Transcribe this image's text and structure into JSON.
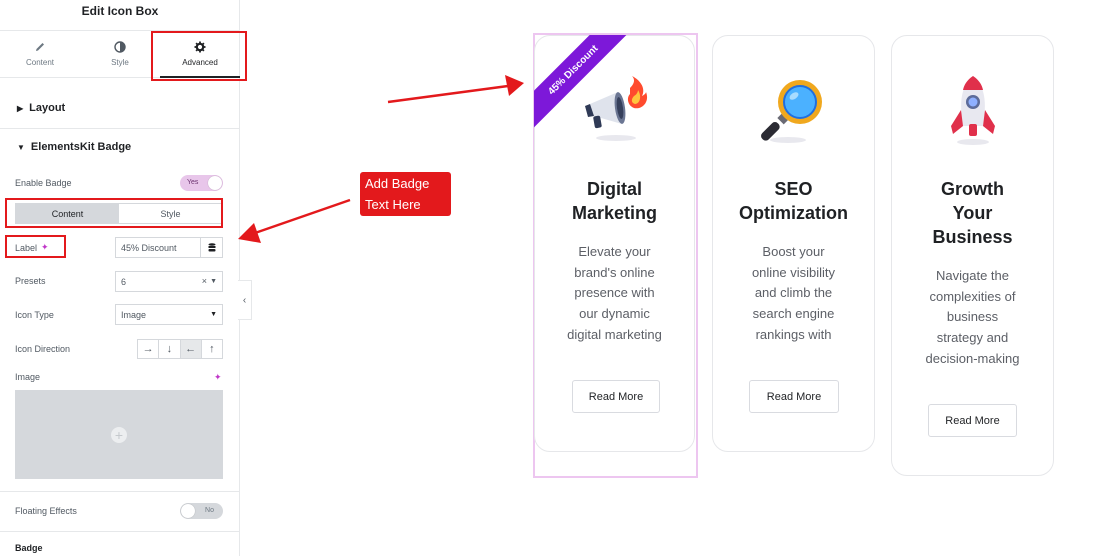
{
  "panel": {
    "title": "Edit Icon Box",
    "tabs": [
      {
        "label": "Content",
        "icon": "pencil-icon"
      },
      {
        "label": "Style",
        "icon": "contrast-icon"
      },
      {
        "label": "Advanced",
        "icon": "gear-icon"
      }
    ],
    "active_tab": "Advanced",
    "sections": {
      "layout": "Layout",
      "badge_section": "ElementsKit Badge",
      "badge_sub": "Badge"
    },
    "enable_badge": {
      "label": "Enable Badge",
      "state": "Yes"
    },
    "inner_tabs": [
      "Content",
      "Style"
    ],
    "label_field": {
      "label": "Label",
      "value": "45% Discount"
    },
    "presets": {
      "label": "Presets",
      "value": "6"
    },
    "icon_type": {
      "label": "Icon Type",
      "value": "Image"
    },
    "icon_direction": {
      "label": "Icon Direction",
      "options": [
        "→",
        "↓",
        "←",
        "↑"
      ],
      "selected": "←"
    },
    "image": {
      "label": "Image"
    },
    "floating_effects": {
      "label": "Floating Effects",
      "state": "No"
    }
  },
  "annotation": {
    "callout_line1": "Add Badge",
    "callout_line2": "Text Here",
    "color": "#e3191c"
  },
  "cards": [
    {
      "title_lines": [
        "Digital",
        "Marketing"
      ],
      "desc_lines": [
        "Elevate your",
        "brand's online",
        "presence with",
        "our dynamic",
        "digital marketing"
      ],
      "button": "Read More",
      "icon": "megaphone-icon",
      "badge": "45% Discount"
    },
    {
      "title_lines": [
        "SEO",
        "Optimization"
      ],
      "desc_lines": [
        "Boost your",
        "online visibility",
        "and climb the",
        "search engine",
        "rankings with"
      ],
      "button": "Read More",
      "icon": "magnifier-icon"
    },
    {
      "title_lines": [
        "Growth",
        "Your",
        "Business"
      ],
      "desc_lines": [
        "Navigate the",
        "complexities of",
        "business",
        "strategy and",
        "decision-making"
      ],
      "button": "Read More",
      "icon": "rocket-icon"
    }
  ],
  "colors": {
    "badge": "#7d18d9",
    "highlight": "#e3191c",
    "accent": "#c036c8"
  }
}
